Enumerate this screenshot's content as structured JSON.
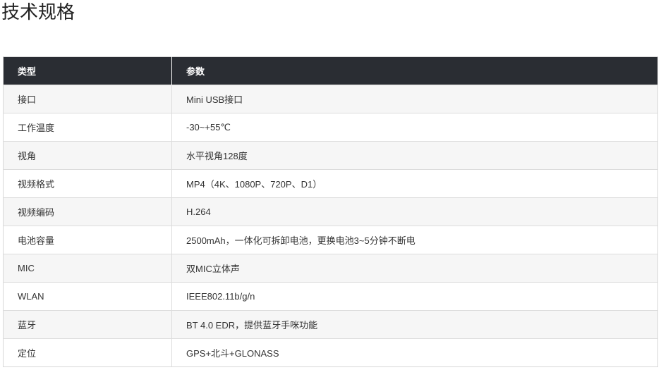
{
  "page": {
    "title": "技术规格"
  },
  "table": {
    "headers": [
      "类型",
      "参数"
    ],
    "rows": [
      [
        "接口",
        "Mini USB接口"
      ],
      [
        "工作温度",
        "-30~+55℃"
      ],
      [
        "视角",
        "水平视角128度"
      ],
      [
        "视频格式",
        "MP4（4K、1080P、720P、D1）"
      ],
      [
        "视频编码",
        "H.264"
      ],
      [
        "电池容量",
        "2500mAh，一体化可拆卸电池，更换电池3~5分钟不断电"
      ],
      [
        "MIC",
        "双MIC立体声"
      ],
      [
        "WLAN",
        "IEEE802.11b/g/n"
      ],
      [
        "蓝牙",
        "BT 4.0 EDR，提供蓝牙手咪功能"
      ],
      [
        "定位",
        "GPS+北斗+GLONASS"
      ]
    ]
  },
  "colors": {
    "header_bg": "#2a2d33",
    "header_text": "#ffffff",
    "row_odd_bg": "#f6f6f6",
    "row_even_bg": "#ffffff",
    "border": "#dcdcdc"
  }
}
